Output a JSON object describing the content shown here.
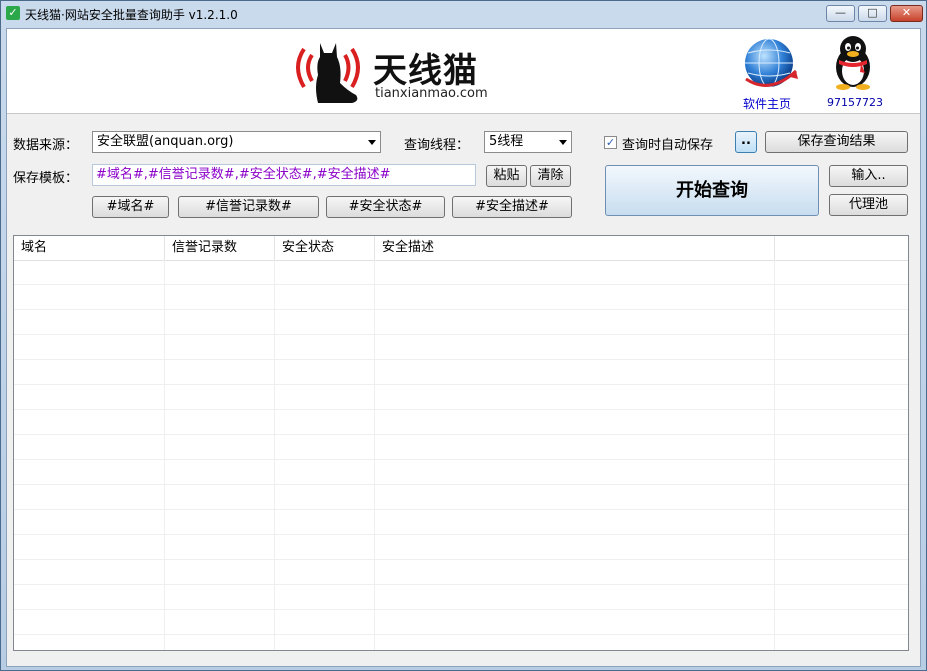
{
  "window": {
    "title": "天线猫·网站安全批量查询助手 v1.2.1.0",
    "controls": {
      "minimize": "—",
      "maximize": "□",
      "close": "✕"
    }
  },
  "banner": {
    "logo_cn": "天线猫",
    "logo_en": "tianxianmao.com",
    "site_link": "软件主页",
    "qq_number": "97157723"
  },
  "form": {
    "source_label": "数据来源：",
    "source_value": "安全联盟(anquan.org)",
    "threads_label": "查询线程：",
    "threads_value": "5线程",
    "auto_save_label": "查询时自动保存",
    "auto_save_checked": true,
    "browse_button": "..",
    "save_results_button": "保存查询结果",
    "template_label": "保存模板：",
    "template_value": "#域名#,#信誉记录数#,#安全状态#,#安全描述#",
    "paste_button": "粘贴",
    "clear_button": "清除",
    "start_button": "开始查询",
    "input_button": "输入..",
    "proxy_button": "代理池",
    "tag_buttons": [
      "#域名#",
      "#信誉记录数#",
      "#安全状态#",
      "#安全描述#"
    ]
  },
  "table": {
    "columns": [
      "域名",
      "信誉记录数",
      "安全状态",
      "安全描述",
      ""
    ],
    "rows": []
  },
  "colors": {
    "template_text": "#8a00c8",
    "link": "#0000cc",
    "titlebar": "#c9daec"
  }
}
